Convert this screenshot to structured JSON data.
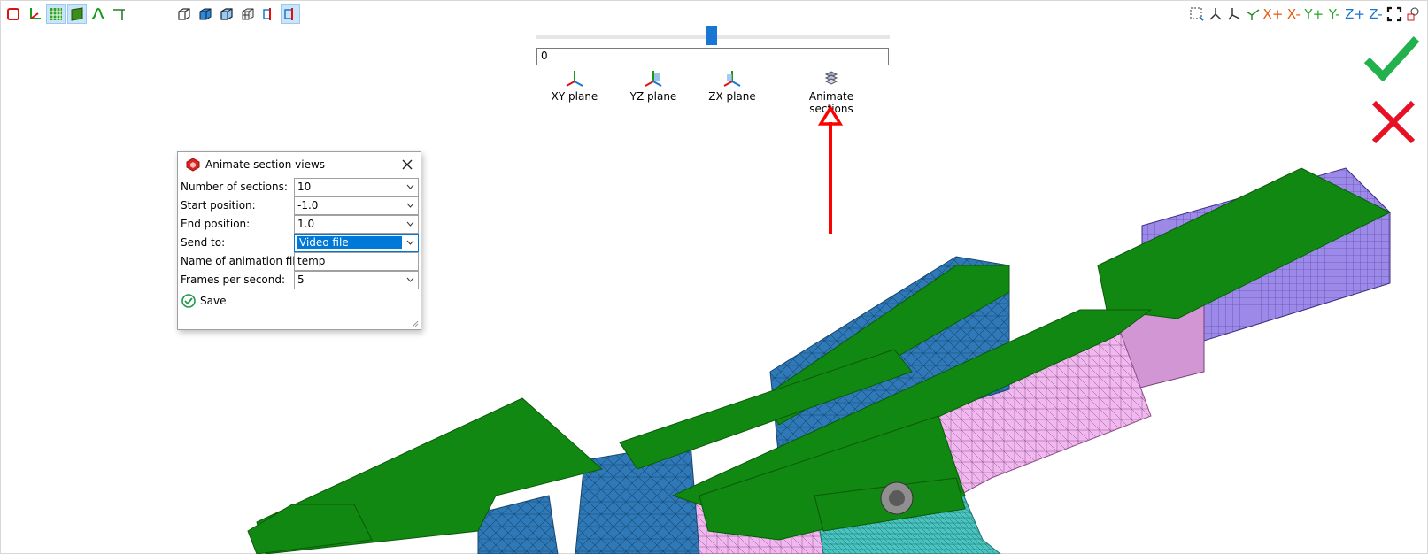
{
  "section_slider": {
    "value": "0"
  },
  "planes": [
    {
      "label": "XY plane"
    },
    {
      "label": "YZ plane"
    },
    {
      "label": "ZX plane"
    },
    {
      "label": "Animate sections"
    }
  ],
  "axis_toolbar": {
    "x_plus": "X+",
    "x_minus": "X-",
    "y_plus": "Y+",
    "y_minus": "Y-",
    "z_plus": "Z+",
    "z_minus": "Z-"
  },
  "dialog": {
    "title": "Animate section views",
    "rows": [
      {
        "label": "Number of sections:",
        "value": "10"
      },
      {
        "label": "Start position:",
        "value": "-1.0"
      },
      {
        "label": "End position:",
        "value": "1.0"
      },
      {
        "label": "Send to:",
        "value": "Video file"
      },
      {
        "label": "Name of animation file:",
        "value": "temp"
      },
      {
        "label": "Frames per second:",
        "value": "5"
      }
    ],
    "save_label": "Save"
  },
  "colors": {
    "accent": "#1976d2",
    "confirm": "#22b14c",
    "cancel": "#e81123",
    "annotation": "#ff0000",
    "mesh_green": "#118811",
    "mesh_blue": "#2f79b8",
    "mesh_pink": "#f0b8ef",
    "mesh_purple": "#9c89e8"
  }
}
